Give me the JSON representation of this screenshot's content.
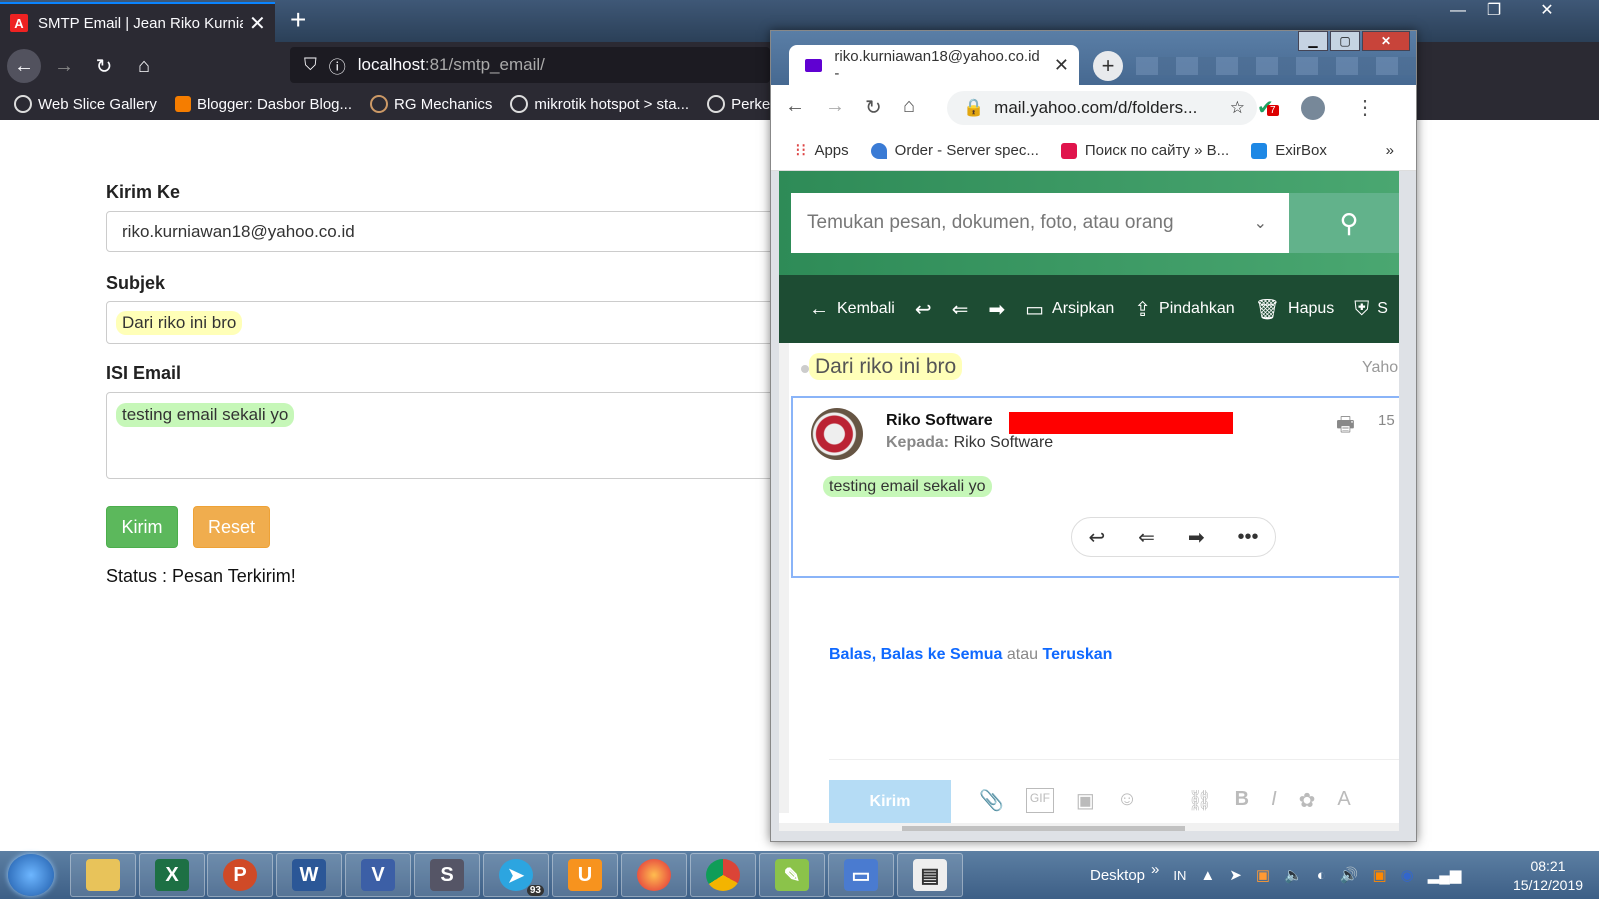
{
  "main_browser": {
    "tab_title": "SMTP Email | Jean Riko Kurniaw",
    "url_host": "localhost",
    "url_rest": ":81/smtp_email/",
    "bookmarks": [
      "Web Slice Gallery",
      "Blogger: Dasbor Blog...",
      "RG Mechanics",
      "mikrotik hotspot > sta...",
      "Perker"
    ]
  },
  "form": {
    "to_label": "Kirim Ke",
    "to_value": "riko.kurniawan18@yahoo.co.id",
    "subject_label": "Subjek",
    "subject_value": "Dari riko ini bro",
    "body_label": "ISI Email",
    "body_value": "testing email sekali yo",
    "send_button": "Kirim",
    "reset_button": "Reset",
    "status": "Status : Pesan Terkirim!"
  },
  "popup": {
    "tab_title": "riko.kurniawan18@yahoo.co.id -",
    "url": "mail.yahoo.com/d/folders...",
    "ext_badge": "7",
    "bookmarks": [
      "Apps",
      "Order - Server spec...",
      "Поиск по сайту » В...",
      "ExirBox"
    ],
    "search_placeholder": "Temukan pesan, dokumen, foto, atau orang",
    "actions": {
      "back": "Kembali",
      "archive": "Arsipkan",
      "move": "Pindahkan",
      "delete": "Hapus",
      "spam": "S"
    },
    "subject": "Dari riko ini bro",
    "yahoo_label": "Yaho",
    "sender": "Riko Software",
    "to_label": "Kepada:",
    "to_name": "Riko Software",
    "date": "15",
    "body": "testing email sekali yo",
    "reply": "Balas",
    "reply_all": "Balas ke Semua",
    "or": "atau",
    "forward": "Teruskan",
    "send": "Kirim"
  },
  "taskbar": {
    "telegram_badge": "93",
    "desktop_label": "Desktop",
    "lang": "IN",
    "time": "08:21",
    "date": "15/12/2019"
  },
  "colors": {
    "accent_green": "#5cb85c",
    "accent_orange": "#f0ad4e",
    "yahoo_dark": "#1d4c33",
    "yahoo_link": "#0f69ff"
  }
}
